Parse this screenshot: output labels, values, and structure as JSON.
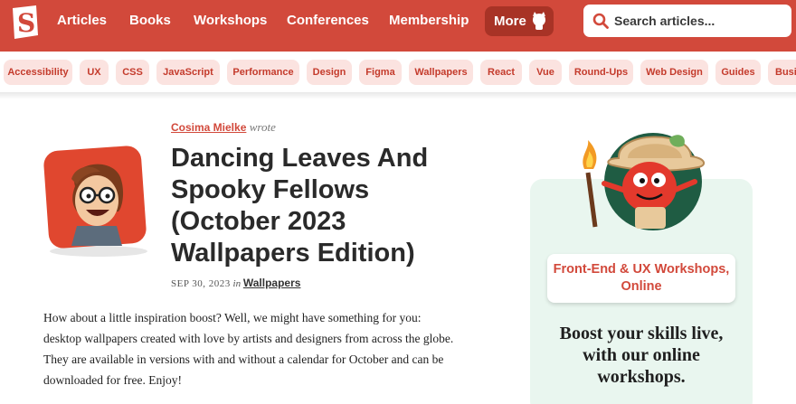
{
  "nav": {
    "items": [
      "Articles",
      "Books",
      "Workshops",
      "Conferences",
      "Membership"
    ],
    "more_label": "More",
    "search_placeholder": "Search articles..."
  },
  "tags": [
    "Accessibility",
    "UX",
    "CSS",
    "JavaScript",
    "Performance",
    "Design",
    "Figma",
    "Wallpapers",
    "React",
    "Vue",
    "Round-Ups",
    "Web Design",
    "Guides",
    "Busi"
  ],
  "article": {
    "author": "Cosima Mielke",
    "wrote": "wrote",
    "title": "Dancing Leaves And Spooky Fellows (October 2023 Wallpapers Edition)",
    "date": "SEP 30, 2023",
    "in": "in",
    "category": "Wallpapers",
    "intro": "How about a little inspiration boost? Well, we might have something for you: desktop wallpapers created with love by artists and designers from across the globe. They are available in versions with and without a calendar for October and can be downloaded for free. Enjoy!"
  },
  "sidebar": {
    "workshop_label": "Front-End & UX Workshops, Online",
    "boost_text": "Boost your skills live, with our online workshops."
  },
  "colors": {
    "brand": "#d2493b",
    "tag_bg": "#fbe3e0",
    "card_bg": "#e9f6ef"
  }
}
